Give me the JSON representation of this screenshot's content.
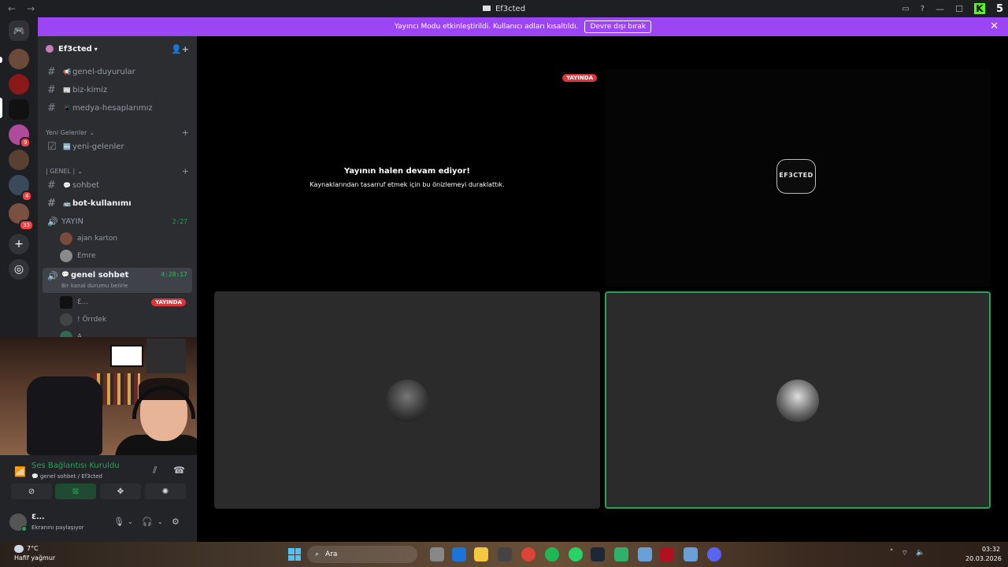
{
  "window": {
    "title": "Ef3cted",
    "kick_count": "5",
    "kick_logo": "K"
  },
  "banner": {
    "message": "Yayıncı Modu etkinleştirildi. Kullanıcı adları kısaltıldı.",
    "button": "Devre dışı bırak"
  },
  "server": {
    "name": "Ef3cted"
  },
  "rail_badges": {
    "b1": "9",
    "b2": "4",
    "b3": "33"
  },
  "channels": {
    "c1": {
      "emoji": "📢",
      "name": "genel-duyurular"
    },
    "c2": {
      "emoji": "📰",
      "name": "biz-kimiz"
    },
    "c3": {
      "emoji": "📱",
      "name": "medya-hesaplarımız"
    },
    "cat1": "Yeni Gelenler",
    "c4": {
      "emoji": "🆕",
      "name": "yeni-gelenler"
    },
    "cat2": "| GENEL |",
    "c5": {
      "emoji": "💬",
      "name": "sohbet"
    },
    "c6": {
      "emoji": "🚌",
      "name": "bot-kullanımı"
    },
    "v1": {
      "name": "YAYIN",
      "time": "2:27"
    },
    "v1_users": [
      "ajan karton",
      "Emre"
    ],
    "v2": {
      "emoji": "💬",
      "name": "genel sohbet",
      "time": "4:28:17",
      "status": "Bir kanal durumu belirle"
    },
    "v2_users": [
      "Ɛ...",
      "! Örrdek",
      "A"
    ],
    "live_label": "YAYINDA"
  },
  "voice": {
    "status": "Ses Bağlantısı Kuruldu",
    "channel": "💬 genel sohbet / Ef3cted"
  },
  "user": {
    "name": "Ɛ...",
    "status": "Ekranını paylaşıyor"
  },
  "stage": {
    "live_label": "YAYINDA",
    "paused_title": "Yayının halen devam ediyor!",
    "paused_sub": "Kaynaklarından tasarruf etmek için bu önizlemeyi duraklattık.",
    "logo_text": "EF3CTED"
  },
  "taskbar": {
    "temp": "7°C",
    "weather": "Hafif yağmur",
    "search": "Ara",
    "time": "03:32",
    "date": "20.03.2026"
  },
  "colors": {
    "accent": "#9b45f5",
    "online": "#23a559",
    "live": "#da373c"
  }
}
